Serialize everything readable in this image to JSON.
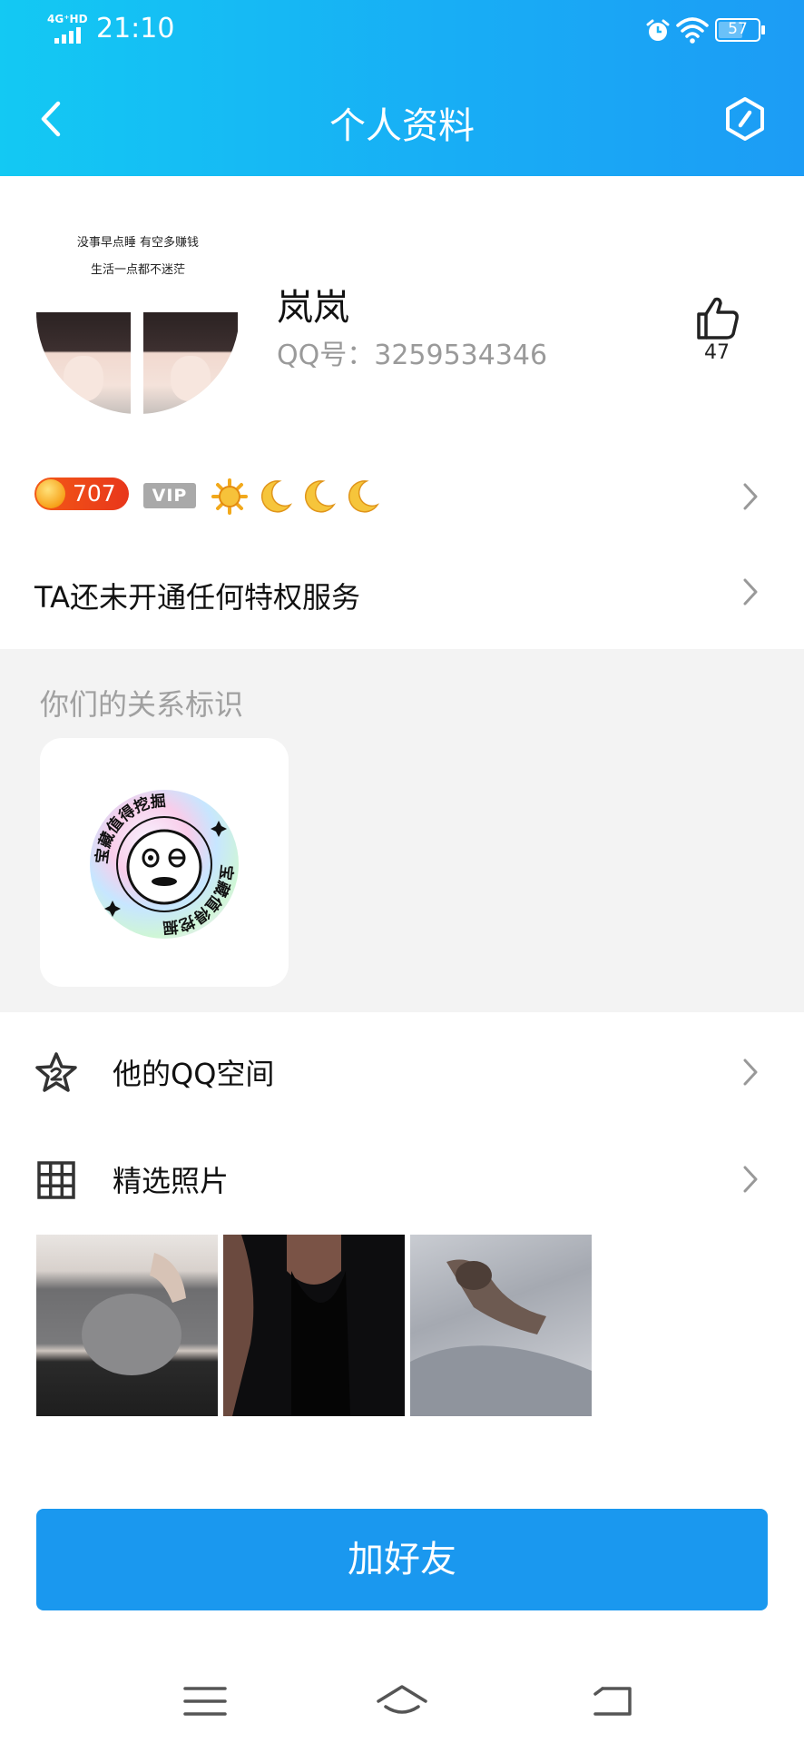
{
  "status_bar": {
    "network": "4G⁺HD",
    "time": "21:10",
    "battery": "57"
  },
  "header": {
    "title": "个人资料",
    "icons": [
      "back-arrow-icon",
      "settings-hexagon-icon"
    ]
  },
  "profile": {
    "avatar_caption_line1": "没事早点睡  有空多赚钱",
    "avatar_caption_line2": "生活一点都不迷茫",
    "name": "岚岚",
    "qq_label": "QQ号：",
    "qq_number": "3259534346",
    "like_count": "47"
  },
  "level": {
    "coin_value": "707",
    "vip_label": "VIP",
    "level_icons": [
      "sun-icon",
      "moon-icon",
      "moon-icon",
      "moon-icon"
    ]
  },
  "privileges": {
    "text": "TA还未开通任何特权服务"
  },
  "relationship": {
    "heading": "你们的关系标识",
    "badge_text": "宝藏值得挖掘"
  },
  "rows": {
    "qzone_label": "他的QQ空间",
    "photos_label": "精选照片"
  },
  "actions": {
    "add_friend": "加好友"
  },
  "colors": {
    "header_start": "#13c9f3",
    "header_end": "#1c9cf5",
    "button": "#1a98ef",
    "section_bg": "#f3f3f3"
  }
}
